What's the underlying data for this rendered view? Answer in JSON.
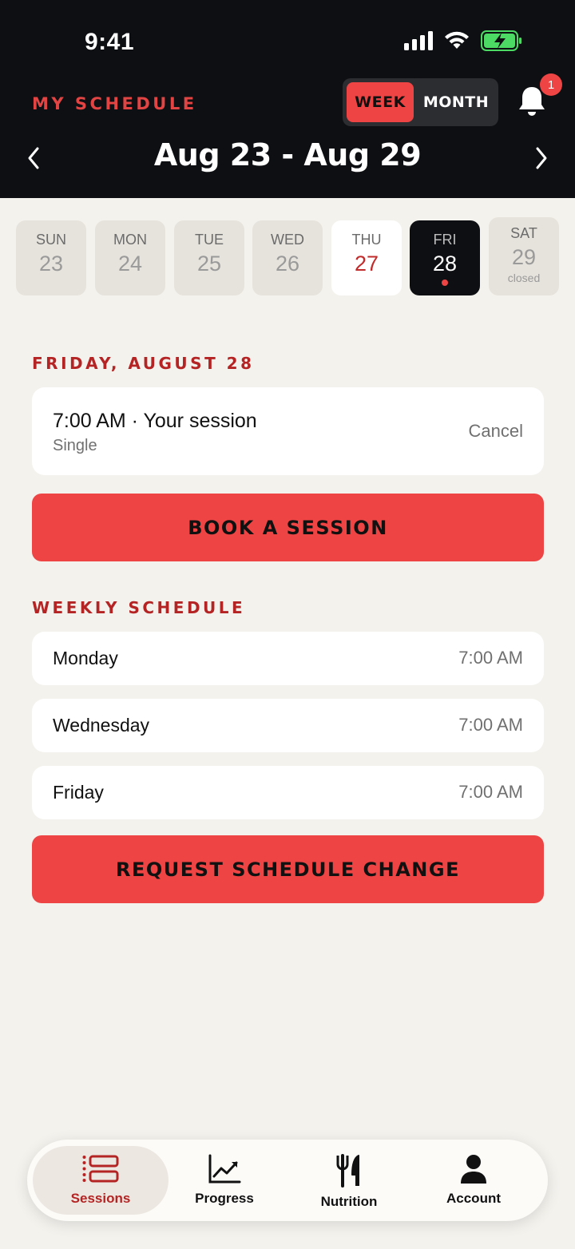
{
  "status": {
    "time": "9:41"
  },
  "header": {
    "title": "MY SCHEDULE",
    "view_toggle": {
      "week": "WEEK",
      "month": "MONTH",
      "selected": "WEEK"
    },
    "notifications": {
      "count": "1"
    },
    "range": "Aug 23 - Aug 29"
  },
  "days": [
    {
      "name": "SUN",
      "date": "23",
      "state": "past"
    },
    {
      "name": "MON",
      "date": "24",
      "state": "past"
    },
    {
      "name": "TUE",
      "date": "25",
      "state": "past"
    },
    {
      "name": "WED",
      "date": "26",
      "state": "past"
    },
    {
      "name": "THU",
      "date": "27",
      "state": "today"
    },
    {
      "name": "FRI",
      "date": "28",
      "state": "selected"
    },
    {
      "name": "SAT",
      "date": "29",
      "state": "closed",
      "note": "closed"
    }
  ],
  "selected_day": {
    "label": "FRIDAY, AUGUST 28",
    "session": {
      "title": "7:00 AM · Your session",
      "type": "Single",
      "cancel_label": "Cancel"
    },
    "book_label": "BOOK A SESSION"
  },
  "weekly": {
    "label": "WEEKLY SCHEDULE",
    "rows": [
      {
        "day": "Monday",
        "time": "7:00 AM"
      },
      {
        "day": "Wednesday",
        "time": "7:00 AM"
      },
      {
        "day": "Friday",
        "time": "7:00 AM"
      }
    ],
    "change_label": "REQUEST SCHEDULE CHANGE"
  },
  "tabs": [
    {
      "label": "Sessions",
      "icon": "sessions-icon",
      "active": true
    },
    {
      "label": "Progress",
      "icon": "progress-chart-icon",
      "active": false
    },
    {
      "label": "Nutrition",
      "icon": "fork-knife-icon",
      "active": false
    },
    {
      "label": "Account",
      "icon": "person-icon",
      "active": false
    }
  ],
  "colors": {
    "accent": "#ef4444",
    "header_bg": "#0e0f12",
    "label_red": "#b52424",
    "page_bg": "#f4f2ed"
  }
}
